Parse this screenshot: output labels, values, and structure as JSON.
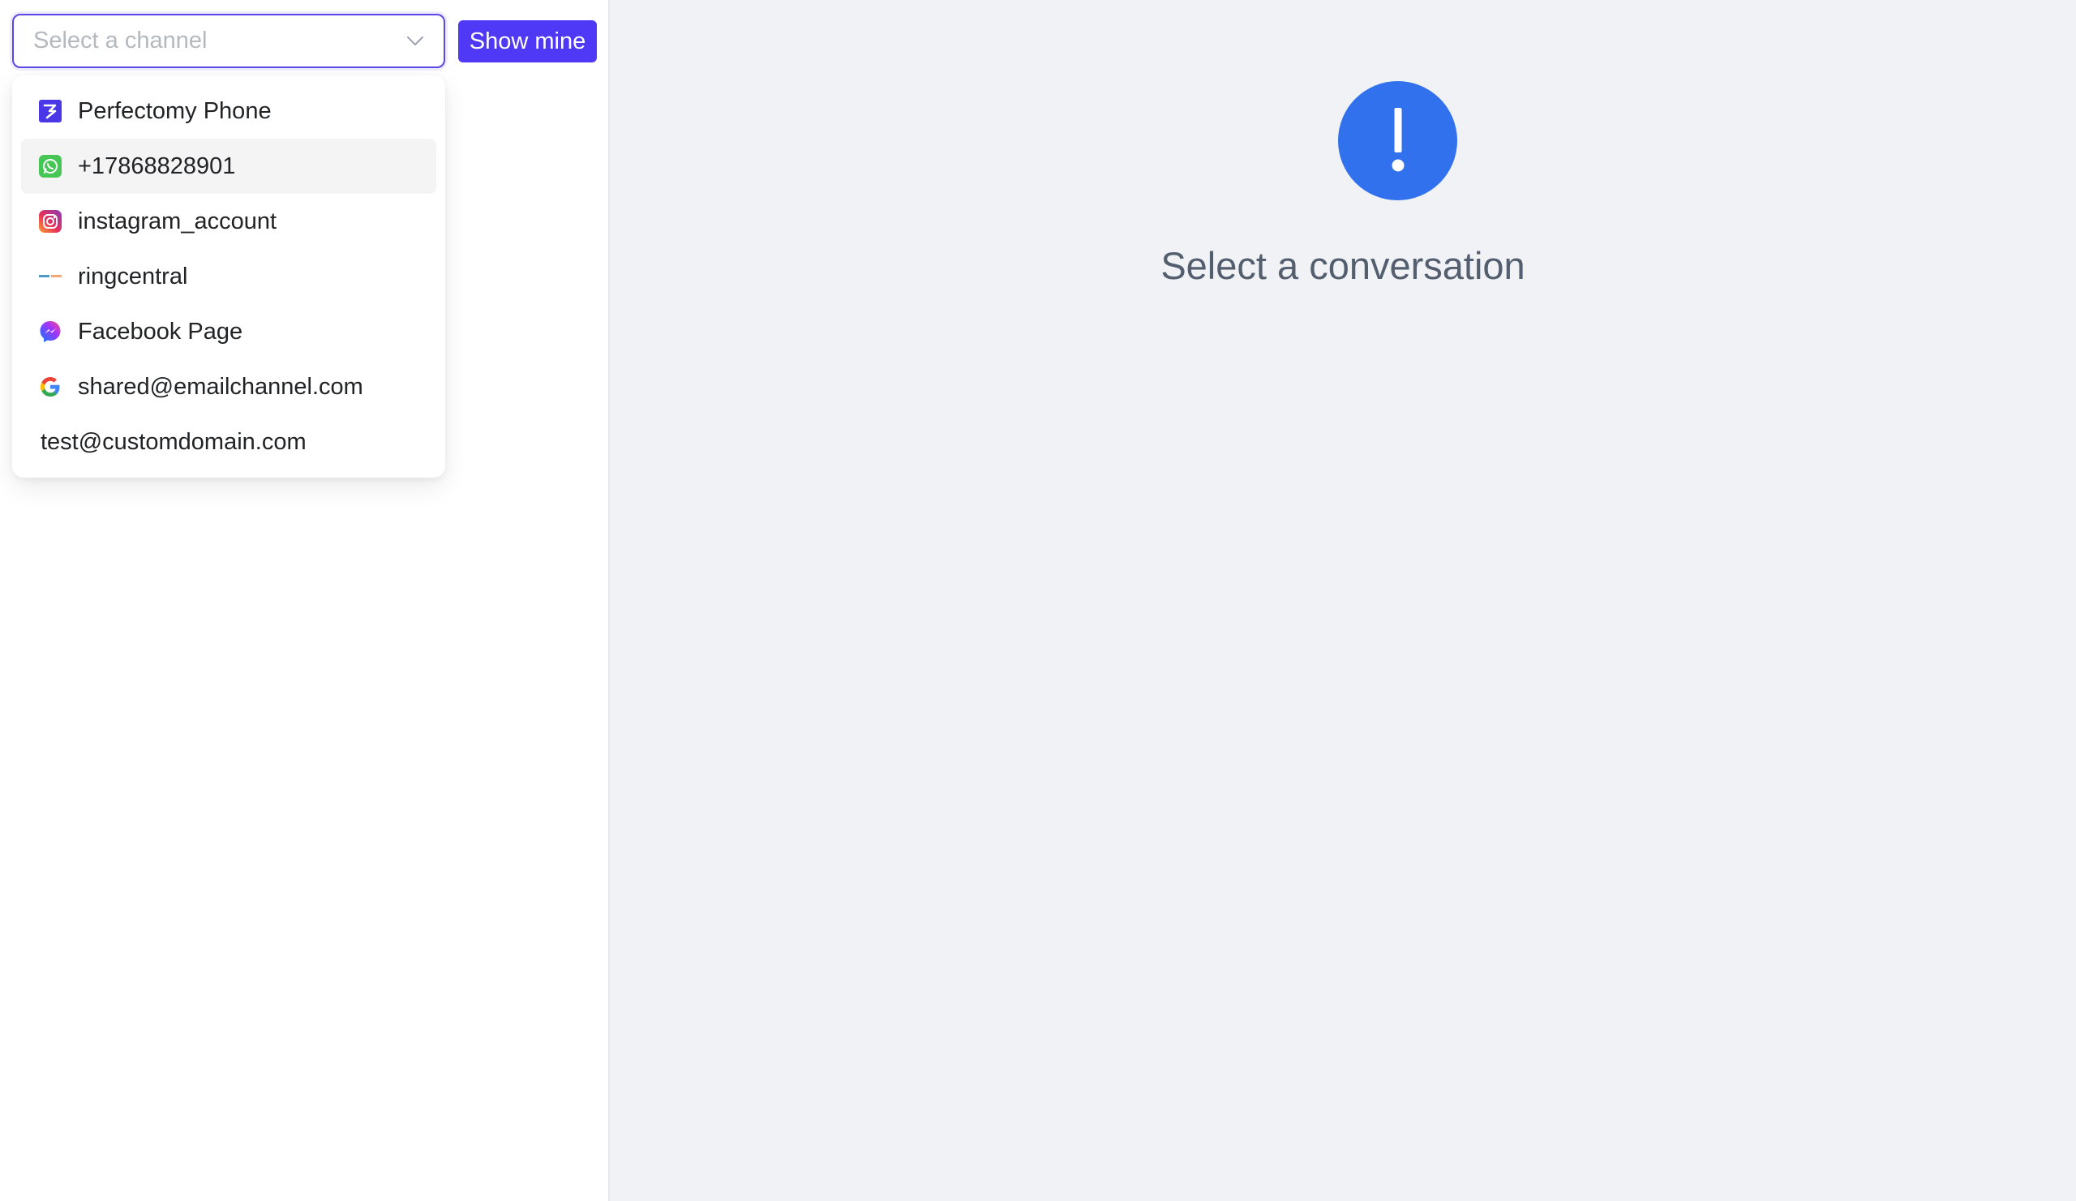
{
  "channel_select": {
    "placeholder": "Select a channel",
    "icon": "chevron-down-icon"
  },
  "show_mine_button": {
    "label": "Show mine",
    "color": "#4f39f6"
  },
  "dropdown": {
    "options": [
      {
        "label": "Perfectomy Phone",
        "icon": "perfectomy-icon",
        "active": false
      },
      {
        "label": "+17868828901",
        "icon": "whatsapp-icon",
        "active": true
      },
      {
        "label": "instagram_account",
        "icon": "instagram-icon",
        "active": false
      },
      {
        "label": "ringcentral",
        "icon": "ringcentral-icon",
        "active": false
      },
      {
        "label": "Facebook Page",
        "icon": "messenger-icon",
        "active": false
      },
      {
        "label": "shared@emailchannel.com",
        "icon": "google-icon",
        "active": false
      },
      {
        "label": "test@customdomain.com",
        "icon": "",
        "active": false
      }
    ]
  },
  "empty_state": {
    "icon": "exclamation-circle-icon",
    "icon_color": "#3271ee",
    "title": "Select a conversation"
  }
}
